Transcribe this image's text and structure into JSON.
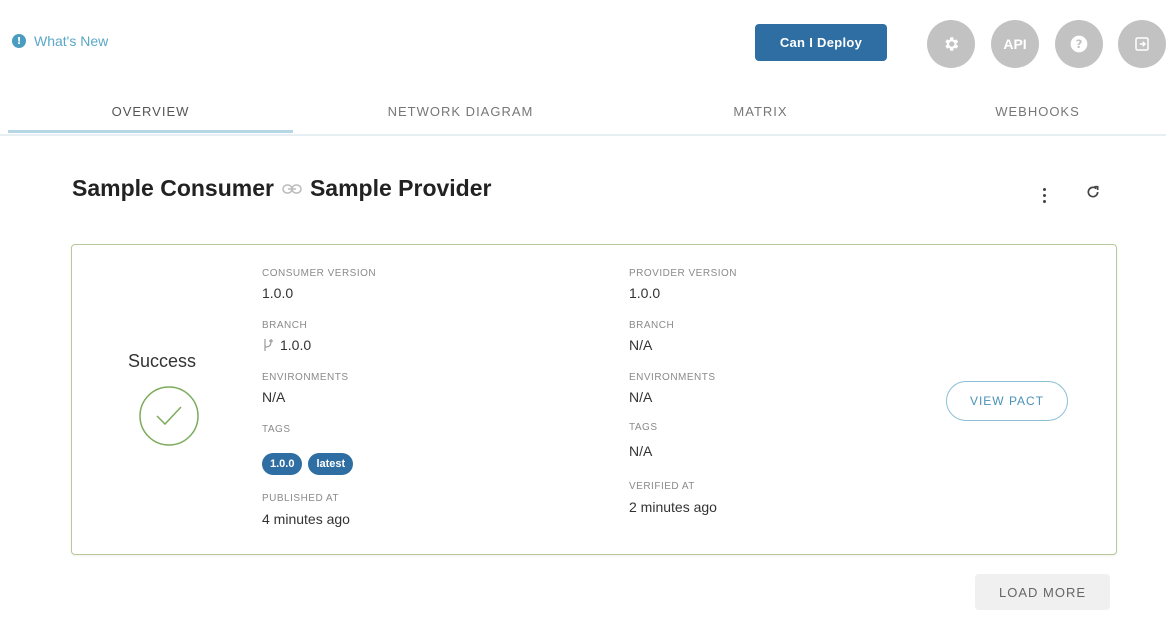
{
  "header": {
    "whats_new": "What's New",
    "whats_new_icon": "info-icon",
    "deploy_label": "Can I Deploy",
    "api_label": "API",
    "icons": [
      "gear-icon",
      "api-icon",
      "help-icon",
      "logout-icon"
    ],
    "accent_color": "#2f6ea3"
  },
  "tabs": [
    {
      "label": "OVERVIEW",
      "active": true
    },
    {
      "label": "NETWORK DIAGRAM",
      "active": false
    },
    {
      "label": "MATRIX",
      "active": false
    },
    {
      "label": "WEBHOOKS",
      "active": false
    }
  ],
  "page": {
    "consumer": "Sample Consumer",
    "provider": "Sample Provider",
    "link_icon": "link-icon",
    "more_icon": "more-vert-icon",
    "refresh_icon": "refresh-icon"
  },
  "card": {
    "status": "Success",
    "status_icon": "check-circle-icon",
    "status_color": "#7cab5c",
    "consumer": {
      "version_label": "CONSUMER VERSION",
      "version": "1.0.0",
      "branch_label": "BRANCH",
      "branch": "1.0.0",
      "branch_icon": "git-branch-icon",
      "environments_label": "ENVIRONMENTS",
      "environments": "N/A",
      "tags_label": "TAGS",
      "tags": [
        "1.0.0",
        "latest"
      ],
      "time_label": "PUBLISHED AT",
      "time": "4 minutes ago"
    },
    "provider": {
      "version_label": "PROVIDER VERSION",
      "version": "1.0.0",
      "branch_label": "BRANCH",
      "branch": "N/A",
      "environments_label": "ENVIRONMENTS",
      "environments": "N/A",
      "tags_label": "TAGS",
      "tags": "N/A",
      "time_label": "VERIFIED AT",
      "time": "2 minutes ago"
    },
    "view_pact": "VIEW PACT"
  },
  "load_more": "LOAD MORE"
}
